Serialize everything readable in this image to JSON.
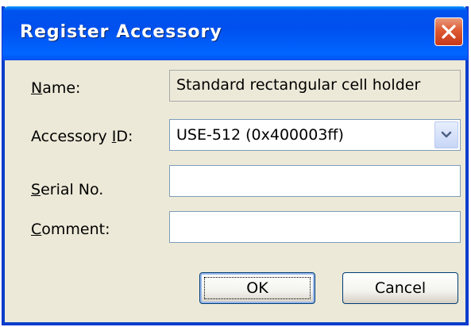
{
  "window": {
    "title": "Register Accessory",
    "close_icon": "close-icon",
    "accent": "#0054e3",
    "close_color": "#dd5a32"
  },
  "form": {
    "name_label": "Name:",
    "name_mnemonic": "N",
    "name_rest": "ame:",
    "name_value": "Standard rectangular cell holder",
    "accessory_label_pre": "Accessory ",
    "accessory_mnemonic": "I",
    "accessory_label_post": "D:",
    "accessory_value": "USE-512 (0x400003ff)",
    "serial_mnemonic": "S",
    "serial_rest": "erial No.",
    "serial_value": "",
    "comment_mnemonic": "C",
    "comment_rest": "omment:",
    "comment_value": ""
  },
  "buttons": {
    "ok_label": "OK",
    "cancel_label": "Cancel"
  }
}
